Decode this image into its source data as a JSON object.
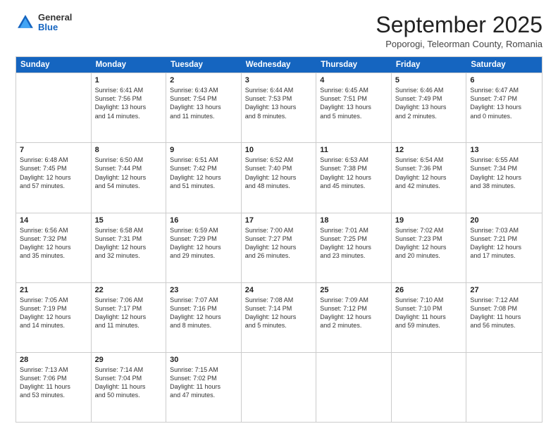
{
  "header": {
    "logo": {
      "general": "General",
      "blue": "Blue"
    },
    "title": "September 2025",
    "location": "Poporogi, Teleorman County, Romania"
  },
  "calendar": {
    "days_of_week": [
      "Sunday",
      "Monday",
      "Tuesday",
      "Wednesday",
      "Thursday",
      "Friday",
      "Saturday"
    ],
    "weeks": [
      [
        {
          "day": "",
          "info": ""
        },
        {
          "day": "1",
          "info": "Sunrise: 6:41 AM\nSunset: 7:56 PM\nDaylight: 13 hours\nand 14 minutes."
        },
        {
          "day": "2",
          "info": "Sunrise: 6:43 AM\nSunset: 7:54 PM\nDaylight: 13 hours\nand 11 minutes."
        },
        {
          "day": "3",
          "info": "Sunrise: 6:44 AM\nSunset: 7:53 PM\nDaylight: 13 hours\nand 8 minutes."
        },
        {
          "day": "4",
          "info": "Sunrise: 6:45 AM\nSunset: 7:51 PM\nDaylight: 13 hours\nand 5 minutes."
        },
        {
          "day": "5",
          "info": "Sunrise: 6:46 AM\nSunset: 7:49 PM\nDaylight: 13 hours\nand 2 minutes."
        },
        {
          "day": "6",
          "info": "Sunrise: 6:47 AM\nSunset: 7:47 PM\nDaylight: 13 hours\nand 0 minutes."
        }
      ],
      [
        {
          "day": "7",
          "info": "Sunrise: 6:48 AM\nSunset: 7:45 PM\nDaylight: 12 hours\nand 57 minutes."
        },
        {
          "day": "8",
          "info": "Sunrise: 6:50 AM\nSunset: 7:44 PM\nDaylight: 12 hours\nand 54 minutes."
        },
        {
          "day": "9",
          "info": "Sunrise: 6:51 AM\nSunset: 7:42 PM\nDaylight: 12 hours\nand 51 minutes."
        },
        {
          "day": "10",
          "info": "Sunrise: 6:52 AM\nSunset: 7:40 PM\nDaylight: 12 hours\nand 48 minutes."
        },
        {
          "day": "11",
          "info": "Sunrise: 6:53 AM\nSunset: 7:38 PM\nDaylight: 12 hours\nand 45 minutes."
        },
        {
          "day": "12",
          "info": "Sunrise: 6:54 AM\nSunset: 7:36 PM\nDaylight: 12 hours\nand 42 minutes."
        },
        {
          "day": "13",
          "info": "Sunrise: 6:55 AM\nSunset: 7:34 PM\nDaylight: 12 hours\nand 38 minutes."
        }
      ],
      [
        {
          "day": "14",
          "info": "Sunrise: 6:56 AM\nSunset: 7:32 PM\nDaylight: 12 hours\nand 35 minutes."
        },
        {
          "day": "15",
          "info": "Sunrise: 6:58 AM\nSunset: 7:31 PM\nDaylight: 12 hours\nand 32 minutes."
        },
        {
          "day": "16",
          "info": "Sunrise: 6:59 AM\nSunset: 7:29 PM\nDaylight: 12 hours\nand 29 minutes."
        },
        {
          "day": "17",
          "info": "Sunrise: 7:00 AM\nSunset: 7:27 PM\nDaylight: 12 hours\nand 26 minutes."
        },
        {
          "day": "18",
          "info": "Sunrise: 7:01 AM\nSunset: 7:25 PM\nDaylight: 12 hours\nand 23 minutes."
        },
        {
          "day": "19",
          "info": "Sunrise: 7:02 AM\nSunset: 7:23 PM\nDaylight: 12 hours\nand 20 minutes."
        },
        {
          "day": "20",
          "info": "Sunrise: 7:03 AM\nSunset: 7:21 PM\nDaylight: 12 hours\nand 17 minutes."
        }
      ],
      [
        {
          "day": "21",
          "info": "Sunrise: 7:05 AM\nSunset: 7:19 PM\nDaylight: 12 hours\nand 14 minutes."
        },
        {
          "day": "22",
          "info": "Sunrise: 7:06 AM\nSunset: 7:17 PM\nDaylight: 12 hours\nand 11 minutes."
        },
        {
          "day": "23",
          "info": "Sunrise: 7:07 AM\nSunset: 7:16 PM\nDaylight: 12 hours\nand 8 minutes."
        },
        {
          "day": "24",
          "info": "Sunrise: 7:08 AM\nSunset: 7:14 PM\nDaylight: 12 hours\nand 5 minutes."
        },
        {
          "day": "25",
          "info": "Sunrise: 7:09 AM\nSunset: 7:12 PM\nDaylight: 12 hours\nand 2 minutes."
        },
        {
          "day": "26",
          "info": "Sunrise: 7:10 AM\nSunset: 7:10 PM\nDaylight: 11 hours\nand 59 minutes."
        },
        {
          "day": "27",
          "info": "Sunrise: 7:12 AM\nSunset: 7:08 PM\nDaylight: 11 hours\nand 56 minutes."
        }
      ],
      [
        {
          "day": "28",
          "info": "Sunrise: 7:13 AM\nSunset: 7:06 PM\nDaylight: 11 hours\nand 53 minutes."
        },
        {
          "day": "29",
          "info": "Sunrise: 7:14 AM\nSunset: 7:04 PM\nDaylight: 11 hours\nand 50 minutes."
        },
        {
          "day": "30",
          "info": "Sunrise: 7:15 AM\nSunset: 7:02 PM\nDaylight: 11 hours\nand 47 minutes."
        },
        {
          "day": "",
          "info": ""
        },
        {
          "day": "",
          "info": ""
        },
        {
          "day": "",
          "info": ""
        },
        {
          "day": "",
          "info": ""
        }
      ]
    ]
  }
}
